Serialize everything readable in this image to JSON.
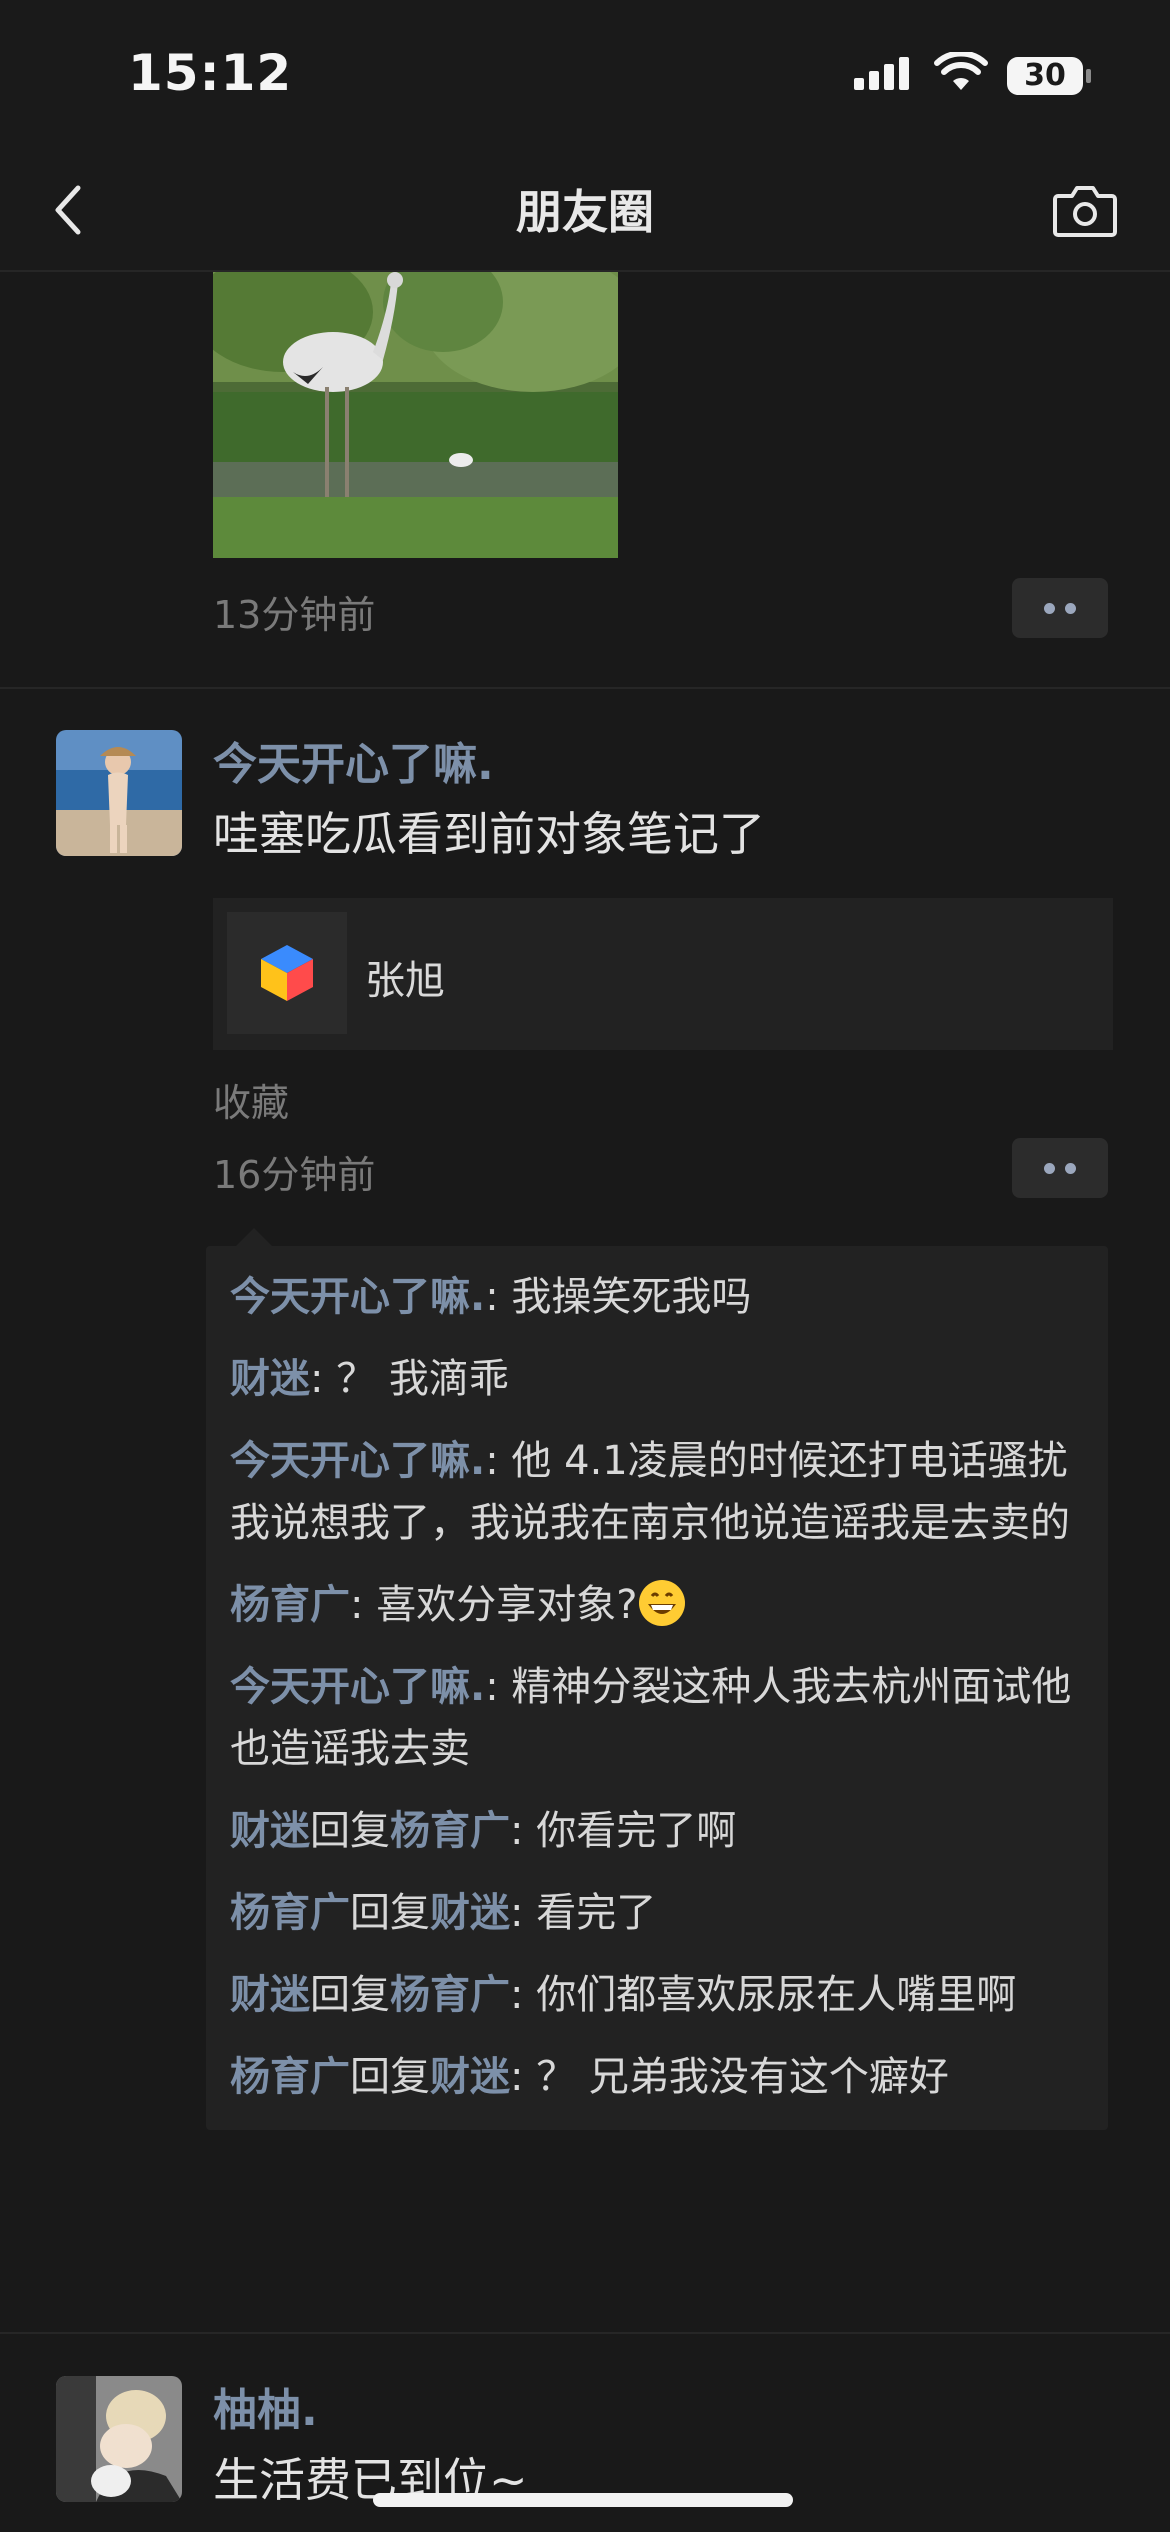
{
  "status_bar": {
    "time": "15:12",
    "battery_level": "30",
    "icons": [
      "signal-icon",
      "wifi-icon",
      "battery-icon"
    ]
  },
  "nav": {
    "title": "朋友圈",
    "back_icon": "chevron-left-icon",
    "camera_icon": "camera-icon"
  },
  "posts": [
    {
      "time": "13分钟前",
      "image": "crane-photo"
    },
    {
      "nickname": "今天开心了嘛.",
      "text": "哇塞吃瓜看到前对象笔记了",
      "link": {
        "title": "张旭",
        "icon": "cube-app-icon"
      },
      "source": "收藏",
      "time": "16分钟前",
      "comments": [
        {
          "name": "今天开心了嘛.",
          "sep": ": ",
          "text": "我操笑死我吗"
        },
        {
          "name": "财迷",
          "sep": ": ",
          "text": "？ 我滴乖"
        },
        {
          "name": "今天开心了嘛.",
          "sep": ": ",
          "text": "他 4.1凌晨的时候还打电话骚扰我说想我了，我说我在南京他说造谣我是去卖的"
        },
        {
          "name": "杨育广",
          "sep": ": ",
          "text": "喜欢分享对象?"
        },
        {
          "name": "今天开心了嘛.",
          "sep": ": ",
          "text": "精神分裂这种人我去杭州面试他也造谣我去卖"
        },
        {
          "name": "财迷",
          "reply_word": "回复",
          "reply_to": "杨育广",
          "sep": ": ",
          "text": "你看完了啊"
        },
        {
          "name": "杨育广",
          "reply_word": "回复",
          "reply_to": "财迷",
          "sep": ": ",
          "text": "看完了"
        },
        {
          "name": "财迷",
          "reply_word": "回复",
          "reply_to": "杨育广",
          "sep": ": ",
          "text": "你们都喜欢尿尿在人嘴里啊"
        },
        {
          "name": "杨育广",
          "reply_word": "回复",
          "reply_to": "财迷",
          "sep": ": ",
          "text": "？ 兄弟我没有这个癖好"
        }
      ]
    },
    {
      "nickname": "柚柚.",
      "text": "生活费已到位~"
    }
  ],
  "colors": {
    "background": "#191919",
    "name_blue": "#7d90a9",
    "text": "#e3e3e3",
    "muted": "#7a7a7a"
  }
}
